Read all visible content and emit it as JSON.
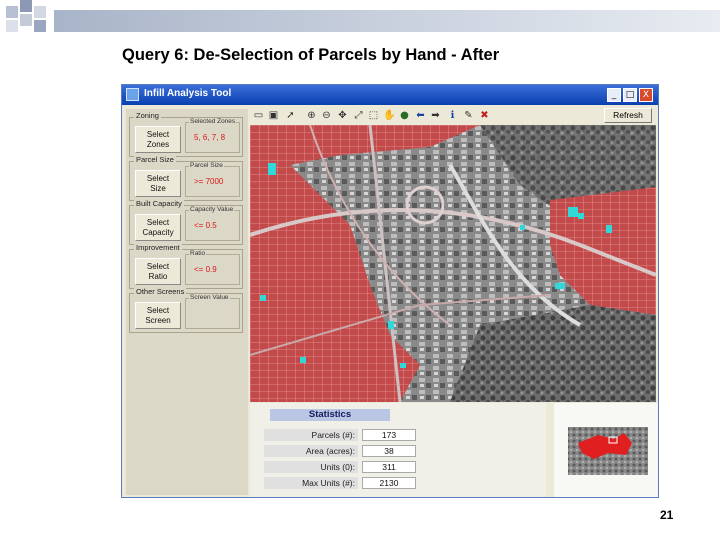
{
  "slide": {
    "title": "Query 6:  De-Selection of Parcels by Hand - After",
    "page_number": "21"
  },
  "window": {
    "title": "Infill Analysis Tool",
    "controls": [
      "_",
      "□",
      "X"
    ]
  },
  "groups": [
    {
      "title": "Zoning",
      "button": "Select\nZones",
      "subtitle": "Selected Zones",
      "value": "5, 6, 7, 8"
    },
    {
      "title": "Parcel Size",
      "button": "Select\nSize",
      "subtitle": "Parcel Size",
      "value": ">= 7000"
    },
    {
      "title": "Built Capacity",
      "button": "Select\nCapacity",
      "subtitle": "Capacity Value",
      "value": "<= 0.5"
    },
    {
      "title": "Improvement",
      "button": "Select\nRatio",
      "subtitle": "Ratio",
      "value": "<= 0.9"
    },
    {
      "title": "Other Screens",
      "button": "Select\nScreen",
      "subtitle": "Screen Value",
      "value": ""
    }
  ],
  "toolbar": {
    "refresh_label": "Refresh",
    "icons": [
      "open-icon",
      "save-icon",
      "pointer-icon",
      "zoom-in-icon",
      "zoom-out-icon",
      "pan-arrows-icon",
      "full-extent-icon",
      "select-icon",
      "hand-icon",
      "globe-icon",
      "back-icon",
      "forward-icon",
      "info-icon",
      "edit-icon",
      "delete-icon"
    ]
  },
  "statistics": {
    "title": "Statistics",
    "rows": [
      {
        "label": "Parcels (#):",
        "value": "173"
      },
      {
        "label": "Area (acres):",
        "value": "38"
      },
      {
        "label": "Units (0):",
        "value": "311"
      },
      {
        "label": "Max Units (#):",
        "value": "2130"
      }
    ]
  },
  "colors": {
    "titlebar": "#0a3fb0",
    "parcel_highlight": "#d22828",
    "value_text": "#d81818",
    "stats_header": "#b9c6e4"
  }
}
